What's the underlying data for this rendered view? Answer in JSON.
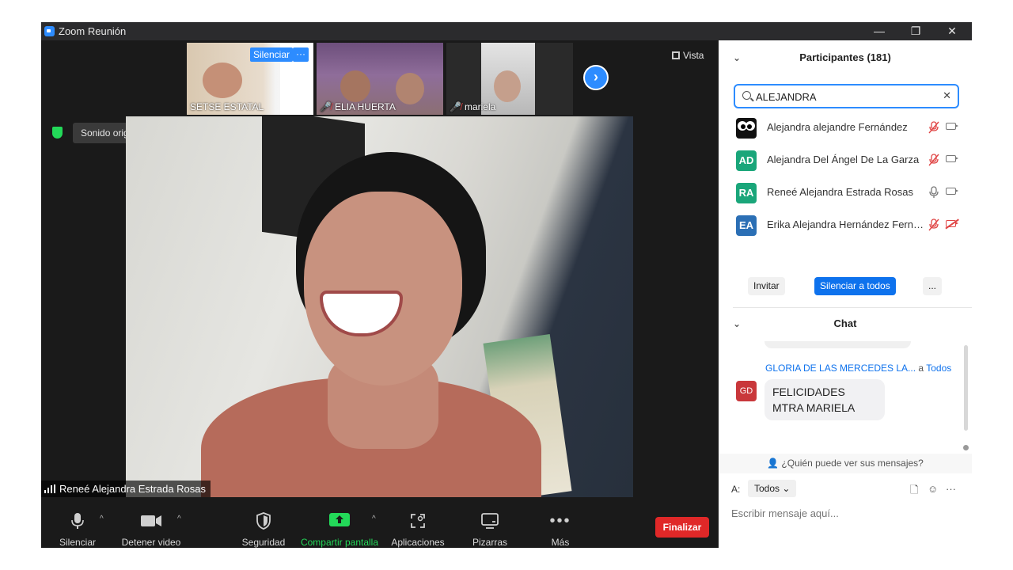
{
  "window": {
    "title": "Zoom Reunión",
    "controls": {
      "minimize": "—",
      "restore": "❐",
      "close": "✕"
    }
  },
  "thumbnails": [
    {
      "name": "SETSE ESTATAL",
      "muted": false
    },
    {
      "name": "ELIA HUERTA",
      "muted": true
    },
    {
      "name": "mariela",
      "muted": true
    }
  ],
  "thumb_actions": {
    "silenciar": "Silenciar",
    "more": "···"
  },
  "view_label": "Vista",
  "sound_status": "Sonido original: desactivado",
  "active_speaker": "Reneé Alejandra Estrada Rosas",
  "toolbar": {
    "mute": "Silenciar",
    "video": "Detener video",
    "security": "Seguridad",
    "share": "Compartir pantalla",
    "apps": "Aplicaciones",
    "whiteboards": "Pizarras",
    "more": "Más",
    "end": "Finalizar"
  },
  "colors": {
    "accent": "#2d8cff",
    "share_green": "#23d959",
    "end_red": "#e02828",
    "mute_red": "#e04545"
  },
  "participants": {
    "title": "Participantes (181)",
    "search_value": "ALEJANDRA",
    "list": [
      {
        "initials": "",
        "name": "Alejandra alejandre Fernández",
        "avatar_color": "#111111",
        "mic": "muted",
        "cam": "on"
      },
      {
        "initials": "AD",
        "name": "Alejandra Del Ángel De La Garza",
        "avatar_color": "#1aa67a",
        "mic": "muted",
        "cam": "on"
      },
      {
        "initials": "RA",
        "name": "Reneé Alejandra Estrada Rosas",
        "avatar_color": "#1aa67a",
        "mic": "on",
        "cam": "on"
      },
      {
        "initials": "EA",
        "name": "Erika Alejandra Hernández Fernández",
        "avatar_color": "#2b6fb5",
        "mic": "muted",
        "cam": "off"
      }
    ],
    "buttons": {
      "invite": "Invitar",
      "mute_all": "Silenciar a todos",
      "more": "..."
    }
  },
  "chat": {
    "title": "Chat",
    "message": {
      "sender": "GLORIA DE LAS MERCEDES LA...",
      "to_prefix": "a",
      "to": "Todos",
      "initials": "GD",
      "text": "FELICIDADES MTRA MARIELA"
    },
    "who_can_see": "¿Quién puede ver sus mensajes?",
    "to_label": "A:",
    "recipient": "Todos",
    "placeholder": "Escribir mensaje aquí..."
  }
}
